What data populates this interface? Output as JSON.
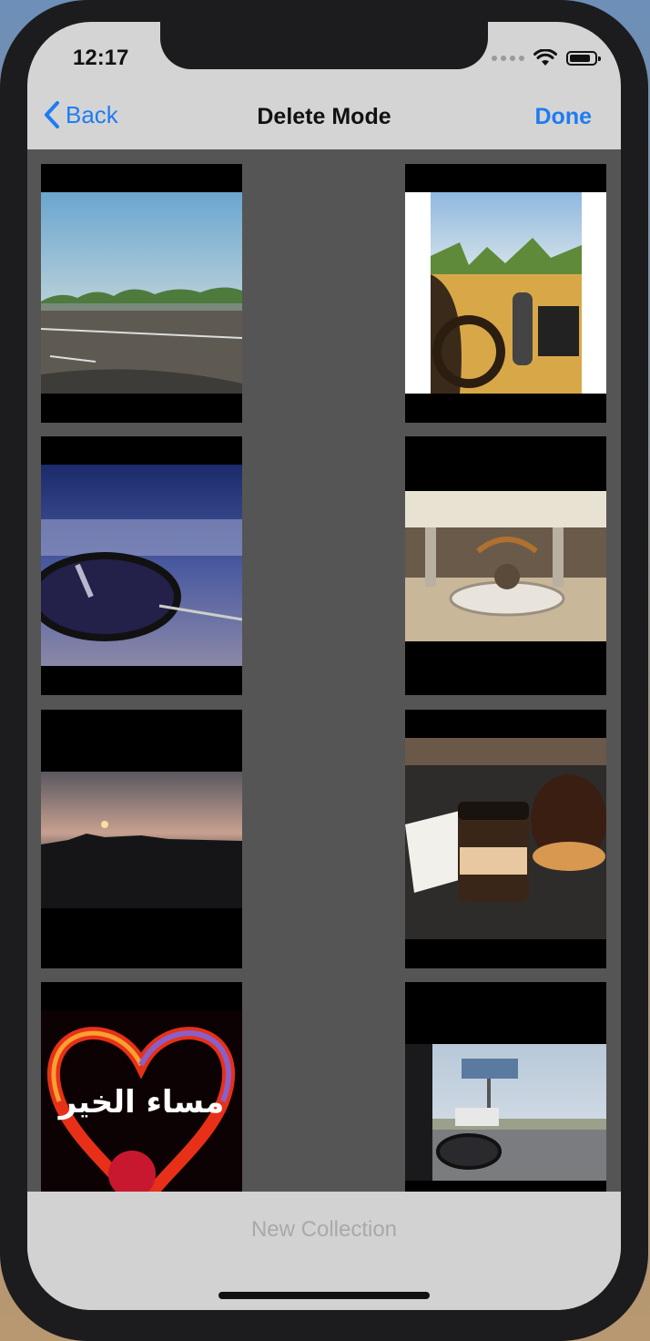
{
  "status_bar": {
    "time": "12:17"
  },
  "navbar": {
    "back_label": "Back",
    "title": "Delete Mode",
    "done_label": "Done"
  },
  "toolbar": {
    "new_collection_label": "New Collection"
  },
  "photos": [
    {
      "overlay_text": ""
    },
    {
      "overlay_text": ""
    },
    {
      "overlay_text": ""
    },
    {
      "overlay_text": ""
    },
    {
      "overlay_text": ""
    },
    {
      "overlay_text": ""
    },
    {
      "overlay_text": "مساء الخير"
    },
    {
      "overlay_text": ""
    }
  ],
  "colors": {
    "accent": "#1e7cf2",
    "nav_bg": "#d4d4d4",
    "grid_bg": "#555555",
    "disabled_text": "#a9a9a9"
  }
}
